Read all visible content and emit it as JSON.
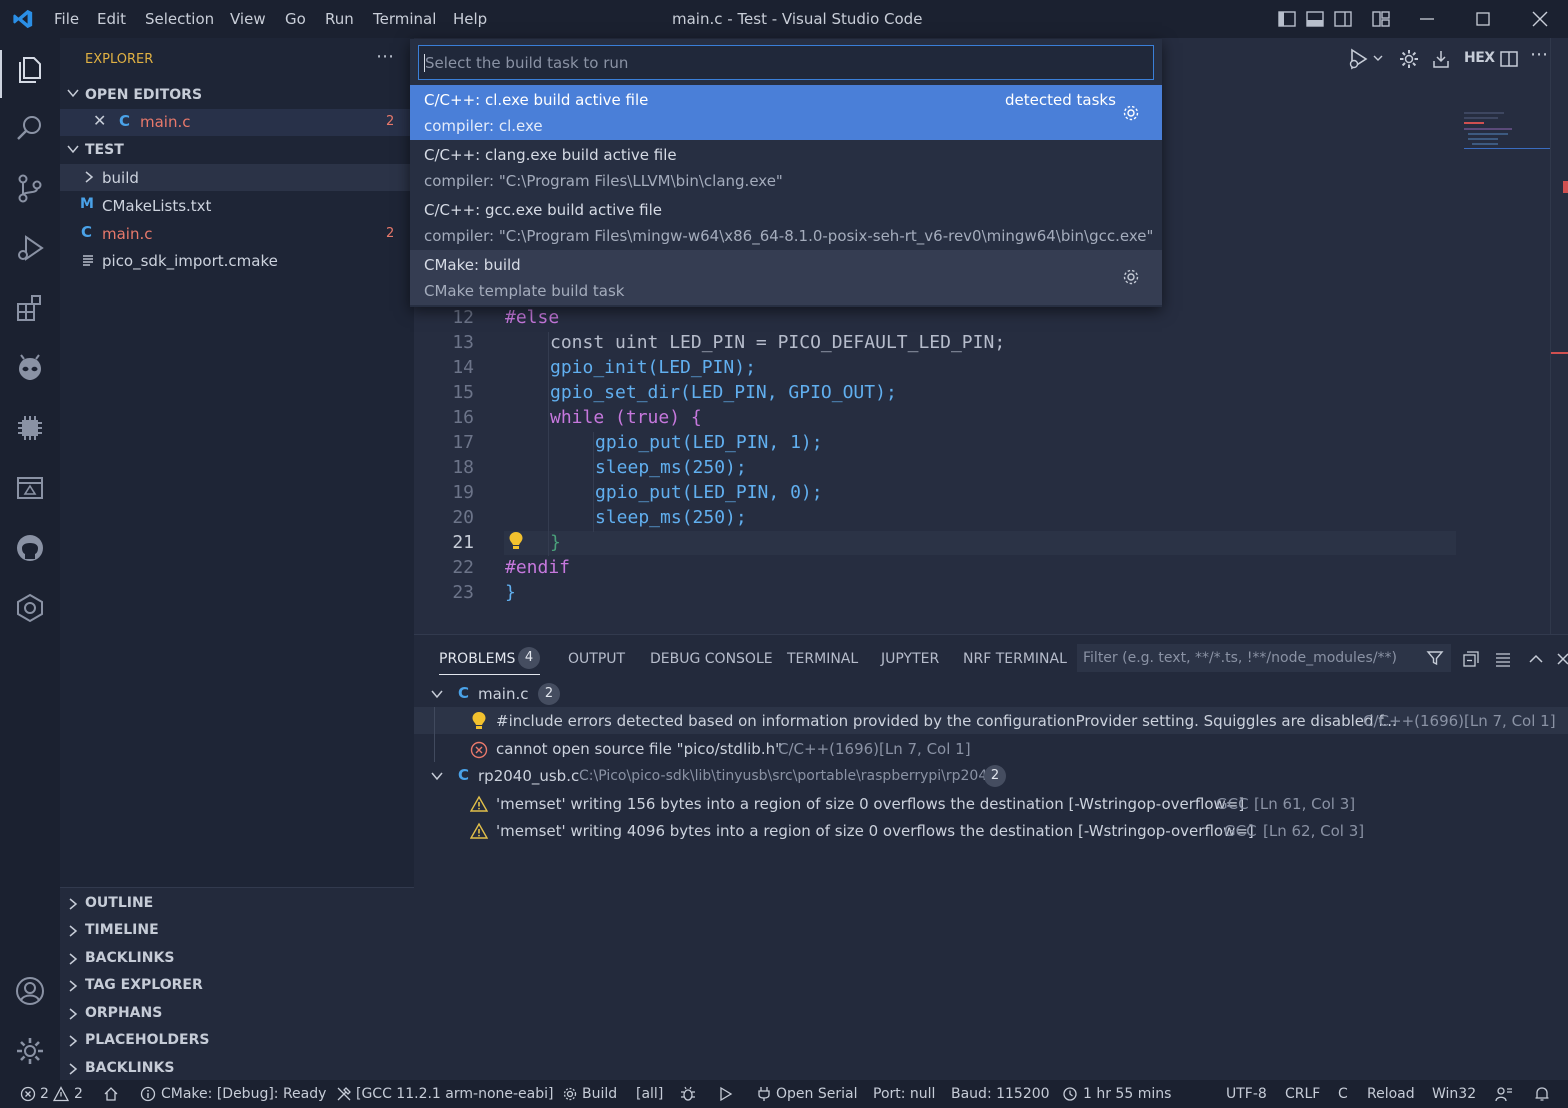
{
  "window": {
    "title": "main.c - Test - Visual Studio Code",
    "menu": [
      "File",
      "Edit",
      "Selection",
      "View",
      "Go",
      "Run",
      "Terminal",
      "Help"
    ]
  },
  "sidebar": {
    "title": "EXPLORER",
    "open_editors_label": "OPEN EDITORS",
    "open_editor_file": "main.c",
    "open_editor_badge": "2",
    "folder_label": "TEST",
    "files": [
      {
        "name": "build",
        "type": "folder"
      },
      {
        "name": "CMakeLists.txt",
        "type": "cmake",
        "icon_letter": "M"
      },
      {
        "name": "main.c",
        "type": "c",
        "badge": "2"
      },
      {
        "name": "pico_sdk_import.cmake",
        "type": "text"
      }
    ],
    "bottom_sections": [
      "OUTLINE",
      "TIMELINE",
      "BACKLINKS",
      "TAG EXPLORER",
      "ORPHANS",
      "PLACEHOLDERS",
      "BACKLINKS"
    ]
  },
  "quick_pick": {
    "placeholder": "Select the build task to run",
    "items": [
      {
        "title": "C/C++: cl.exe build active file",
        "description": "compiler: cl.exe",
        "tag": "detected tasks",
        "selected": true
      },
      {
        "title": "C/C++: clang.exe build active file",
        "description": "compiler: \"C:\\Program Files\\LLVM\\bin\\clang.exe\""
      },
      {
        "title": "C/C++: gcc.exe build active file",
        "description": "compiler: \"C:\\Program Files\\mingw-w64\\x86_64-8.1.0-posix-seh-rt_v6-rev0\\mingw64\\bin\\gcc.exe\""
      },
      {
        "title": "CMake: build",
        "description": "CMake template build task"
      }
    ]
  },
  "editor": {
    "toolbar_hex": "HEX",
    "lines": [
      {
        "n": "12",
        "text": "#else"
      },
      {
        "n": "13",
        "text": "const uint LED_PIN = PICO_DEFAULT_LED_PIN;"
      },
      {
        "n": "14",
        "text": "gpio_init(LED_PIN);"
      },
      {
        "n": "15",
        "text": "gpio_set_dir(LED_PIN, GPIO_OUT);"
      },
      {
        "n": "16",
        "text": "while (true) {"
      },
      {
        "n": "17",
        "text": "gpio_put(LED_PIN, 1);"
      },
      {
        "n": "18",
        "text": "sleep_ms(250);"
      },
      {
        "n": "19",
        "text": "gpio_put(LED_PIN, 0);"
      },
      {
        "n": "20",
        "text": "sleep_ms(250);"
      },
      {
        "n": "21",
        "text": "}"
      },
      {
        "n": "22",
        "text": "#endif"
      },
      {
        "n": "23",
        "text": "}"
      }
    ]
  },
  "panel": {
    "tabs": [
      "PROBLEMS",
      "OUTPUT",
      "DEBUG CONSOLE",
      "TERMINAL",
      "JUPYTER",
      "NRF TERMINAL"
    ],
    "problems_count": "4",
    "filter_placeholder": "Filter (e.g. text, **/*.ts, !**/node_modules/**)",
    "groups": [
      {
        "file": "main.c",
        "path": "",
        "count": "2",
        "items": [
          {
            "severity": "info",
            "message": "#include errors detected based on information provided by the configurationProvider setting. Squiggles are disabled f...",
            "source": "C/C++(1696)",
            "location": "[Ln 7, Col 1]"
          },
          {
            "severity": "error",
            "message": "cannot open source file \"pico/stdlib.h\"",
            "source": "C/C++(1696)",
            "location": "[Ln 7, Col 1]"
          }
        ]
      },
      {
        "file": "rp2040_usb.c",
        "path": "C:\\Pico\\pico-sdk\\lib\\tinyusb\\src\\portable\\raspberrypi\\rp2040",
        "count": "2",
        "items": [
          {
            "severity": "warning",
            "message": "'memset' writing 156 bytes into a region of size 0 overflows the destination [-Wstringop-overflow=]",
            "source": "GCC",
            "location": "[Ln 61, Col 3]"
          },
          {
            "severity": "warning",
            "message": "'memset' writing 4096 bytes into a region of size 0 overflows the destination [-Wstringop-overflow=]",
            "source": "GCC",
            "location": "[Ln 62, Col 3]"
          }
        ]
      }
    ]
  },
  "statusbar": {
    "errors": "2",
    "warnings": "2",
    "cmake_status": "CMake: [Debug]: Ready",
    "kit": "[GCC 11.2.1 arm-none-eabi]",
    "build": "Build",
    "target": "[all]",
    "open_serial": "Open Serial",
    "port": "Port: null",
    "baud": "Baud: 115200",
    "time": "1 hr 55 mins",
    "encoding": "UTF-8",
    "eol": "CRLF",
    "language": "C",
    "reload": "Reload",
    "platform": "Win32"
  },
  "colors": {
    "accent": "#0078d4",
    "selection": "#4a7fd8",
    "error": "#e8796b",
    "warning": "#e2c04a",
    "keyword": "#c678dd",
    "function": "#61afef",
    "number": "#d19a66"
  }
}
